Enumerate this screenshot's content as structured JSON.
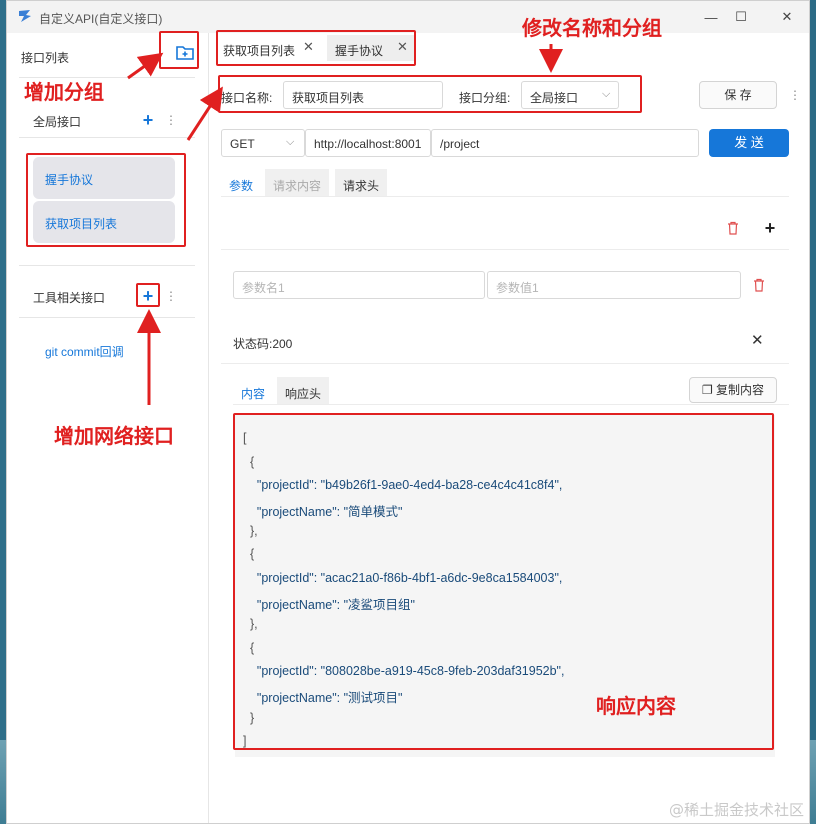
{
  "window": {
    "title": "自定义API(自定义接口)",
    "controls": {
      "minimize": "—",
      "maximize": "☐",
      "close": "✕"
    }
  },
  "sidebar": {
    "title": "接口列表",
    "groups": [
      {
        "name": "全局接口",
        "items": [
          "握手协议",
          "获取项目列表"
        ]
      },
      {
        "name": "工具相关接口",
        "items": [
          "git commit回调"
        ]
      }
    ]
  },
  "tabs": [
    {
      "label": "获取项目列表",
      "active": true
    },
    {
      "label": "握手协议",
      "active": false
    }
  ],
  "editor": {
    "name_label": "接口名称:",
    "name_value": "获取项目列表",
    "group_label": "接口分组:",
    "group_value": "全局接口",
    "save_label": "保 存",
    "method": "GET",
    "host": "http://localhost:8001",
    "path": "/project",
    "send_label": "发 送"
  },
  "request_tabs": [
    "参数",
    "请求内容",
    "请求头"
  ],
  "params": {
    "name_placeholder": "参数名1",
    "value_placeholder": "参数值1"
  },
  "response": {
    "status": "状态码:200",
    "tabs": [
      "内容",
      "响应头"
    ],
    "copy_label": "复制内容",
    "lines": [
      "[",
      "  {",
      "    \"projectId\": \"b49b26f1-9ae0-4ed4-ba28-ce4c4c41c8f4\",",
      "    \"projectName\": \"简单模式\"",
      "  },",
      "  {",
      "    \"projectId\": \"acac21a0-f86b-4bf1-a6dc-9e8ca1584003\",",
      "    \"projectName\": \"凌鲨项目组\"",
      "  },",
      "  {",
      "    \"projectId\": \"808028be-a919-45c8-9feb-203daf31952b\",",
      "    \"projectName\": \"测试项目\"",
      "  }",
      "]"
    ]
  },
  "annotations": {
    "add_group": "增加分组",
    "rename_group": "修改名称和分组",
    "add_api": "增加网络接口",
    "response_content": "响应内容"
  },
  "watermark": "@稀土掘金技术社区",
  "colors": {
    "accent": "#1677d9",
    "annotation": "#e02020"
  }
}
